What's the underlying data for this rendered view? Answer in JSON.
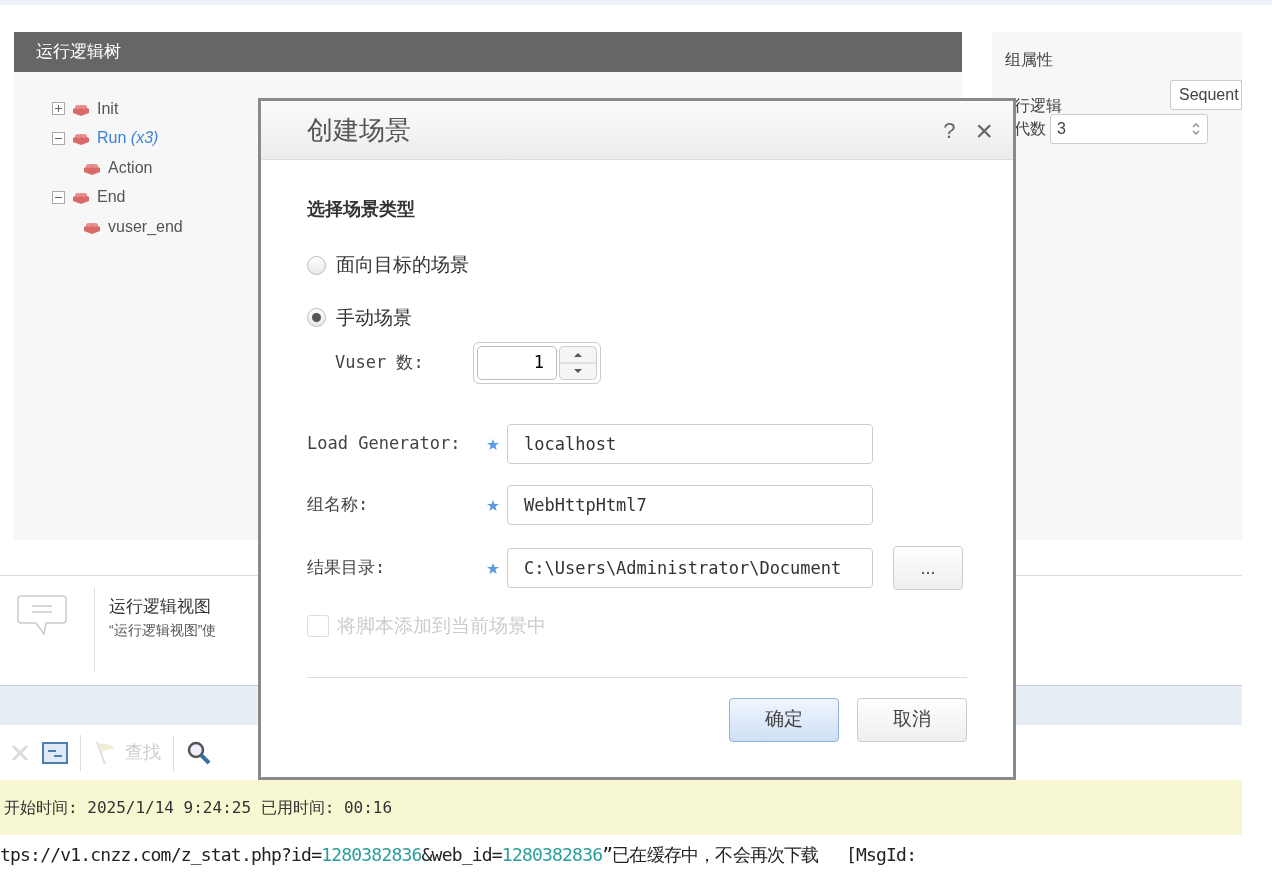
{
  "logic_tree": {
    "title": "运行逻辑树",
    "nodes": [
      {
        "label": "Init",
        "expanded": false,
        "selected": false
      },
      {
        "label": "Run",
        "note": "(x3)",
        "expanded": true,
        "selected": true,
        "children": [
          {
            "label": "Action",
            "selected": false
          }
        ]
      },
      {
        "label": "End",
        "expanded": true,
        "selected": false,
        "children": [
          {
            "label": "vuser_end",
            "selected": false
          }
        ]
      }
    ]
  },
  "group_properties": {
    "title": "组属性",
    "run_logic_label": "行逻辑",
    "run_logic_value": "Sequent",
    "iterations_label": "代数",
    "iterations_value": "3"
  },
  "description": {
    "title": "运行逻辑视图",
    "text": "“运行逻辑视图”使"
  },
  "toolbar": {
    "find_label": "查找"
  },
  "status_bar": {
    "text": "开始时间: 2025/1/14 9:24:25 已用时间: 00:16"
  },
  "log_line": [
    {
      "text": "tps://v1.cnzz.com/z_stat.php?id=",
      "color": "#222222"
    },
    {
      "text": "1280382836",
      "color": "#2a9d9a"
    },
    {
      "text": "&web_id=",
      "color": "#222222"
    },
    {
      "text": "1280382836",
      "color": "#2a9d9a"
    },
    {
      "text": "”已在缓存中，不会再次下载　 [MsgId:",
      "color": "#222222"
    }
  ],
  "dialog": {
    "title": "创建场景",
    "help": "?",
    "close": "×",
    "section_title": "选择场景类型",
    "scenario_types": [
      {
        "label": "面向目标的场景",
        "selected": false
      },
      {
        "label": "手动场景",
        "selected": true
      }
    ],
    "vuser_label": "Vuser 数:",
    "vuser_value": "1",
    "fields": [
      {
        "label": "Load Generator:",
        "required": true,
        "value": "localhost",
        "kind": "text"
      },
      {
        "label": "组名称:",
        "required": true,
        "value": "WebHttpHtml7",
        "kind": "text"
      },
      {
        "label": "结果目录:",
        "required": true,
        "value": "C:\\Users\\Administrator\\Document",
        "kind": "path",
        "browse": "..."
      }
    ],
    "add_script": {
      "label": "将脚本添加到当前场景中",
      "checked": false,
      "disabled": true
    },
    "buttons": [
      {
        "label": "确定",
        "kind": "primary"
      },
      {
        "label": "取消",
        "kind": "secondary"
      }
    ]
  }
}
